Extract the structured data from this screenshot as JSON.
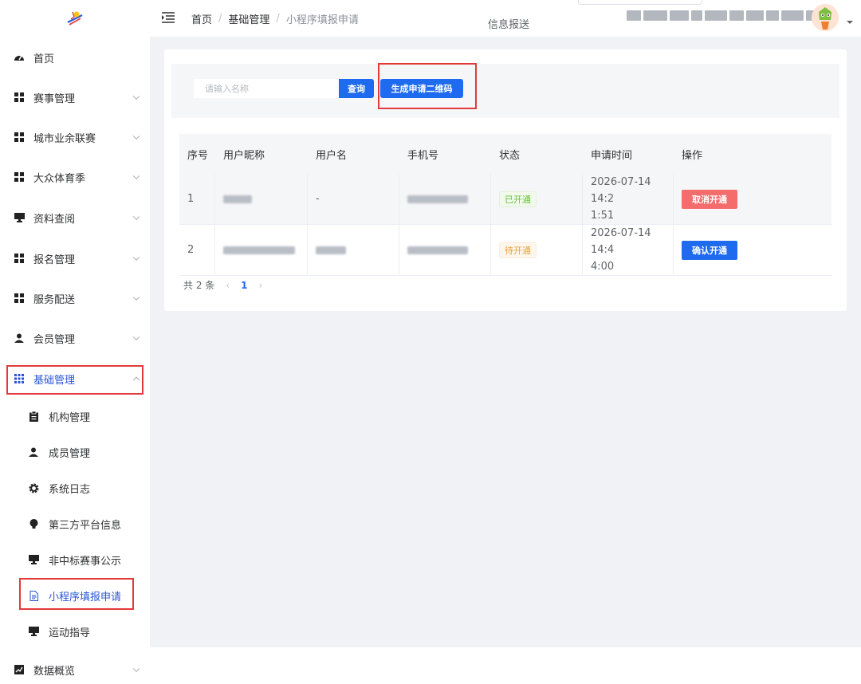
{
  "sidebar": {
    "items": [
      {
        "label": "首页"
      },
      {
        "label": "赛事管理"
      },
      {
        "label": "城市业余联赛"
      },
      {
        "label": "大众体育季"
      },
      {
        "label": "资料查阅"
      },
      {
        "label": "报名管理"
      },
      {
        "label": "服务配送"
      },
      {
        "label": "会员管理"
      },
      {
        "label": "基础管理"
      },
      {
        "label": "数据概览"
      }
    ],
    "sub_items": [
      {
        "label": "机构管理"
      },
      {
        "label": "成员管理"
      },
      {
        "label": "系统日志"
      },
      {
        "label": "第三方平台信息"
      },
      {
        "label": "非中标赛事公示"
      },
      {
        "label": "小程序填报申请"
      },
      {
        "label": "运动指导"
      }
    ]
  },
  "header": {
    "breadcrumb": [
      "首页",
      "基础管理",
      "小程序填报申请"
    ],
    "center_text": "信息报送"
  },
  "search": {
    "placeholder": "请输入名称",
    "query_label": "查询",
    "qr_label": "生成申请二维码"
  },
  "table": {
    "headers": [
      "序号",
      "用户昵称",
      "用户名",
      "手机号",
      "状态",
      "申请时间",
      "操作"
    ],
    "rows": [
      {
        "index": "1",
        "username": "-",
        "status": "已开通",
        "time_line1": "2026-07-14 14:2",
        "time_line2": "1:51",
        "action": "取消开通"
      },
      {
        "index": "2",
        "username": "",
        "status": "待开通",
        "time_line1": "2026-07-14 14:4",
        "time_line2": "4:00",
        "action": "确认开通"
      }
    ]
  },
  "pagination": {
    "total": "共 2 条",
    "prev": "‹",
    "current": "1",
    "next": "›"
  },
  "colors": {
    "primary": "#1f6bf0",
    "danger": "#f56c6c",
    "success": "#67c23a",
    "warning": "#e6a23c",
    "highlight_box": "#e4393c",
    "active_menu": "#2b54d9"
  }
}
